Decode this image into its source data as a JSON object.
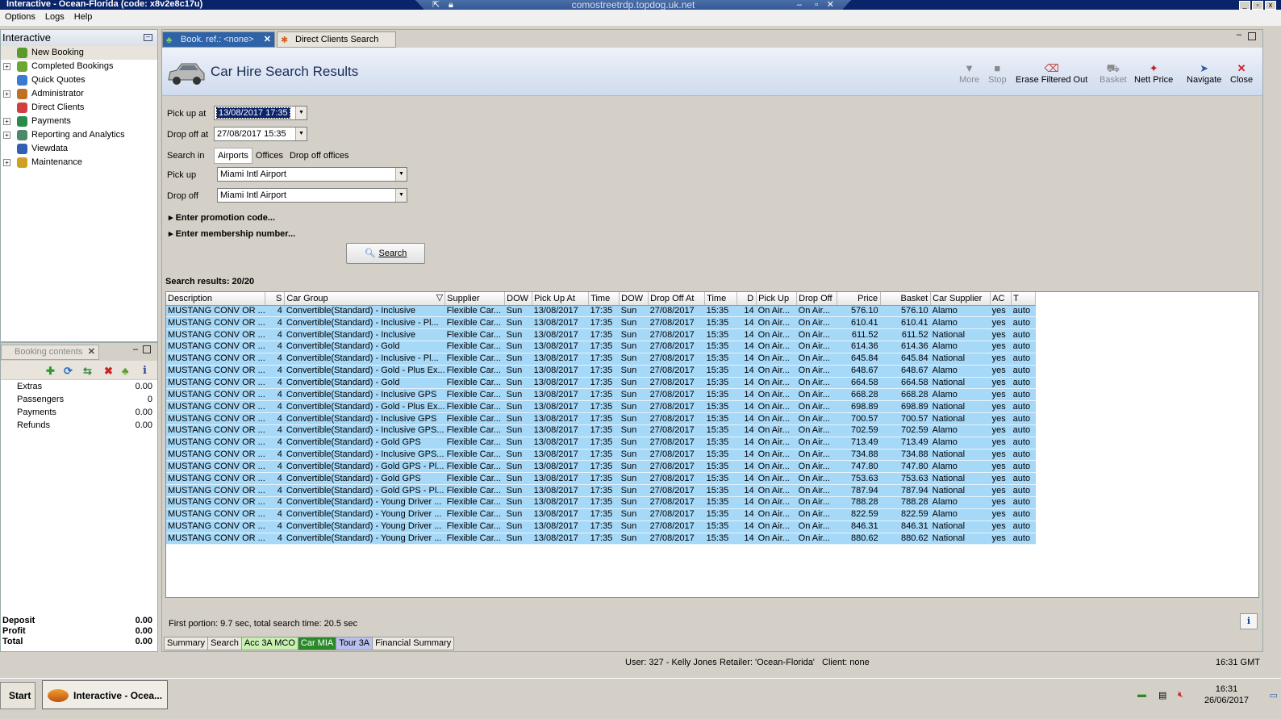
{
  "window": {
    "title": "Interactive - Ocean-Florida (code: x8v2e8c17u)",
    "rdp_host": "comostreetrdp.topdog.uk.net"
  },
  "menu": [
    "Options",
    "Logs",
    "Help"
  ],
  "tree": {
    "title": "Interactive",
    "items": [
      {
        "label": "New Booking",
        "expand": "",
        "color": "#5a9a2a",
        "sel": true
      },
      {
        "label": "Completed Bookings",
        "expand": "+",
        "color": "#6aa830"
      },
      {
        "label": "Quick Quotes",
        "expand": "",
        "color": "#3a7ad0"
      },
      {
        "label": "Administrator",
        "expand": "+",
        "color": "#c07020"
      },
      {
        "label": "Direct Clients",
        "expand": "",
        "color": "#d04040"
      },
      {
        "label": "Payments",
        "expand": "+",
        "color": "#2a8a4a"
      },
      {
        "label": "Reporting and Analytics",
        "expand": "+",
        "color": "#4a8a6a"
      },
      {
        "label": "Viewdata",
        "expand": "",
        "color": "#3060b0"
      },
      {
        "label": "Maintenance",
        "expand": "+",
        "color": "#d0a020"
      }
    ]
  },
  "booking": {
    "tab": "Booking contents",
    "rows": [
      {
        "label": "Extras",
        "value": "0.00"
      },
      {
        "label": "Passengers",
        "value": "0"
      },
      {
        "label": "Payments",
        "value": "0.00"
      },
      {
        "label": "Refunds",
        "value": "0.00"
      }
    ],
    "totals": [
      {
        "label": "Deposit",
        "value": "0.00"
      },
      {
        "label": "Profit",
        "value": "0.00"
      },
      {
        "label": "Total",
        "value": "0.00"
      }
    ]
  },
  "tabs": {
    "t1": "Book. ref.: <none>",
    "t2": "Direct Clients Search"
  },
  "header": {
    "title": "Car Hire Search Results"
  },
  "toolbar": {
    "more": "More",
    "stop": "Stop",
    "erase": "Erase Filtered Out",
    "basket": "Basket",
    "nett": "Nett Price",
    "navigate": "Navigate",
    "close": "Close"
  },
  "form": {
    "pickup_at_label": "Pick up at",
    "pickup_at": "13/08/2017 17:35",
    "dropoff_at_label": "Drop off at",
    "dropoff_at": "27/08/2017 15:35",
    "search_in_label": "Search in",
    "search_in": [
      "Airports",
      "Offices",
      "Drop off offices"
    ],
    "pickup_label": "Pick up",
    "pickup": "Miami Intl Airport",
    "dropoff_label": "Drop off",
    "dropoff": "Miami Intl Airport",
    "promo": "Enter promotion code...",
    "membership": "Enter membership number...",
    "search_btn": "Search"
  },
  "results_label": "Search results: 20/20",
  "columns": [
    "Description",
    "S",
    "Car Group",
    "Supplier",
    "DOW",
    "Pick Up At",
    "Time",
    "DOW",
    "Drop Off At",
    "Time",
    "D",
    "Pick Up",
    "Drop Off",
    "Price",
    "Basket",
    "Car Supplier",
    "AC",
    "T"
  ],
  "rows": [
    [
      "MUSTANG CONV OR ...",
      "4",
      "Convertible(Standard) - Inclusive",
      "Flexible Car...",
      "Sun",
      "13/08/2017",
      "17:35",
      "Sun",
      "27/08/2017",
      "15:35",
      "14",
      "On Air...",
      "On Air...",
      "576.10",
      "576.10",
      "Alamo",
      "yes",
      "auto"
    ],
    [
      "MUSTANG CONV OR ...",
      "4",
      "Convertible(Standard) - Inclusive - Pl...",
      "Flexible Car...",
      "Sun",
      "13/08/2017",
      "17:35",
      "Sun",
      "27/08/2017",
      "15:35",
      "14",
      "On Air...",
      "On Air...",
      "610.41",
      "610.41",
      "Alamo",
      "yes",
      "auto"
    ],
    [
      "MUSTANG CONV OR ...",
      "4",
      "Convertible(Standard) - Inclusive",
      "Flexible Car...",
      "Sun",
      "13/08/2017",
      "17:35",
      "Sun",
      "27/08/2017",
      "15:35",
      "14",
      "On Air...",
      "On Air...",
      "611.52",
      "611.52",
      "National",
      "yes",
      "auto"
    ],
    [
      "MUSTANG CONV OR ...",
      "4",
      "Convertible(Standard) - Gold",
      "Flexible Car...",
      "Sun",
      "13/08/2017",
      "17:35",
      "Sun",
      "27/08/2017",
      "15:35",
      "14",
      "On Air...",
      "On Air...",
      "614.36",
      "614.36",
      "Alamo",
      "yes",
      "auto"
    ],
    [
      "MUSTANG CONV OR ...",
      "4",
      "Convertible(Standard) - Inclusive - Pl...",
      "Flexible Car...",
      "Sun",
      "13/08/2017",
      "17:35",
      "Sun",
      "27/08/2017",
      "15:35",
      "14",
      "On Air...",
      "On Air...",
      "645.84",
      "645.84",
      "National",
      "yes",
      "auto"
    ],
    [
      "MUSTANG CONV OR ...",
      "4",
      "Convertible(Standard) - Gold - Plus Ex...",
      "Flexible Car...",
      "Sun",
      "13/08/2017",
      "17:35",
      "Sun",
      "27/08/2017",
      "15:35",
      "14",
      "On Air...",
      "On Air...",
      "648.67",
      "648.67",
      "Alamo",
      "yes",
      "auto"
    ],
    [
      "MUSTANG CONV OR ...",
      "4",
      "Convertible(Standard) - Gold",
      "Flexible Car...",
      "Sun",
      "13/08/2017",
      "17:35",
      "Sun",
      "27/08/2017",
      "15:35",
      "14",
      "On Air...",
      "On Air...",
      "664.58",
      "664.58",
      "National",
      "yes",
      "auto"
    ],
    [
      "MUSTANG CONV OR ...",
      "4",
      "Convertible(Standard) - Inclusive GPS",
      "Flexible Car...",
      "Sun",
      "13/08/2017",
      "17:35",
      "Sun",
      "27/08/2017",
      "15:35",
      "14",
      "On Air...",
      "On Air...",
      "668.28",
      "668.28",
      "Alamo",
      "yes",
      "auto"
    ],
    [
      "MUSTANG CONV OR ...",
      "4",
      "Convertible(Standard) - Gold - Plus Ex...",
      "Flexible Car...",
      "Sun",
      "13/08/2017",
      "17:35",
      "Sun",
      "27/08/2017",
      "15:35",
      "14",
      "On Air...",
      "On Air...",
      "698.89",
      "698.89",
      "National",
      "yes",
      "auto"
    ],
    [
      "MUSTANG CONV OR ...",
      "4",
      "Convertible(Standard) - Inclusive GPS",
      "Flexible Car...",
      "Sun",
      "13/08/2017",
      "17:35",
      "Sun",
      "27/08/2017",
      "15:35",
      "14",
      "On Air...",
      "On Air...",
      "700.57",
      "700.57",
      "National",
      "yes",
      "auto"
    ],
    [
      "MUSTANG CONV OR ...",
      "4",
      "Convertible(Standard) - Inclusive GPS...",
      "Flexible Car...",
      "Sun",
      "13/08/2017",
      "17:35",
      "Sun",
      "27/08/2017",
      "15:35",
      "14",
      "On Air...",
      "On Air...",
      "702.59",
      "702.59",
      "Alamo",
      "yes",
      "auto"
    ],
    [
      "MUSTANG CONV OR ...",
      "4",
      "Convertible(Standard) - Gold GPS",
      "Flexible Car...",
      "Sun",
      "13/08/2017",
      "17:35",
      "Sun",
      "27/08/2017",
      "15:35",
      "14",
      "On Air...",
      "On Air...",
      "713.49",
      "713.49",
      "Alamo",
      "yes",
      "auto"
    ],
    [
      "MUSTANG CONV OR ...",
      "4",
      "Convertible(Standard) - Inclusive GPS...",
      "Flexible Car...",
      "Sun",
      "13/08/2017",
      "17:35",
      "Sun",
      "27/08/2017",
      "15:35",
      "14",
      "On Air...",
      "On Air...",
      "734.88",
      "734.88",
      "National",
      "yes",
      "auto"
    ],
    [
      "MUSTANG CONV OR ...",
      "4",
      "Convertible(Standard) - Gold GPS - Pl...",
      "Flexible Car...",
      "Sun",
      "13/08/2017",
      "17:35",
      "Sun",
      "27/08/2017",
      "15:35",
      "14",
      "On Air...",
      "On Air...",
      "747.80",
      "747.80",
      "Alamo",
      "yes",
      "auto"
    ],
    [
      "MUSTANG CONV OR ...",
      "4",
      "Convertible(Standard) - Gold GPS",
      "Flexible Car...",
      "Sun",
      "13/08/2017",
      "17:35",
      "Sun",
      "27/08/2017",
      "15:35",
      "14",
      "On Air...",
      "On Air...",
      "753.63",
      "753.63",
      "National",
      "yes",
      "auto"
    ],
    [
      "MUSTANG CONV OR ...",
      "4",
      "Convertible(Standard) - Gold GPS - Pl...",
      "Flexible Car...",
      "Sun",
      "13/08/2017",
      "17:35",
      "Sun",
      "27/08/2017",
      "15:35",
      "14",
      "On Air...",
      "On Air...",
      "787.94",
      "787.94",
      "National",
      "yes",
      "auto"
    ],
    [
      "MUSTANG CONV OR ...",
      "4",
      "Convertible(Standard) - Young Driver ...",
      "Flexible Car...",
      "Sun",
      "13/08/2017",
      "17:35",
      "Sun",
      "27/08/2017",
      "15:35",
      "14",
      "On Air...",
      "On Air...",
      "788.28",
      "788.28",
      "Alamo",
      "yes",
      "auto"
    ],
    [
      "MUSTANG CONV OR ...",
      "4",
      "Convertible(Standard) - Young Driver ...",
      "Flexible Car...",
      "Sun",
      "13/08/2017",
      "17:35",
      "Sun",
      "27/08/2017",
      "15:35",
      "14",
      "On Air...",
      "On Air...",
      "822.59",
      "822.59",
      "Alamo",
      "yes",
      "auto"
    ],
    [
      "MUSTANG CONV OR ...",
      "4",
      "Convertible(Standard) - Young Driver ...",
      "Flexible Car...",
      "Sun",
      "13/08/2017",
      "17:35",
      "Sun",
      "27/08/2017",
      "15:35",
      "14",
      "On Air...",
      "On Air...",
      "846.31",
      "846.31",
      "National",
      "yes",
      "auto"
    ],
    [
      "MUSTANG CONV OR ...",
      "4",
      "Convertible(Standard) - Young Driver ...",
      "Flexible Car...",
      "Sun",
      "13/08/2017",
      "17:35",
      "Sun",
      "27/08/2017",
      "15:35",
      "14",
      "On Air...",
      "On Air...",
      "880.62",
      "880.62",
      "National",
      "yes",
      "auto"
    ]
  ],
  "footer_timing": "First portion: 9.7 sec, total search time: 20.5 sec",
  "bottom_tabs": [
    {
      "label": "Summary",
      "color": "#ece9e2"
    },
    {
      "label": "Search",
      "color": "#ece9e2"
    },
    {
      "label": "Acc 3A MCO",
      "color": "#c8f0b0"
    },
    {
      "label": "Car MIA",
      "color": "#2a8a2a"
    },
    {
      "label": "Tour 3A",
      "color": "#b8c0f0"
    },
    {
      "label": "Financial Summary",
      "color": "#ece9e2"
    }
  ],
  "status": {
    "user": "User: 327 - Kelly Jones",
    "retailer": "Retailer: 'Ocean-Florida'",
    "client": "Client: none",
    "time": "16:31 GMT"
  },
  "taskbar": {
    "start": "Start",
    "task": "Interactive - Ocea...",
    "clock_time": "16:31",
    "clock_date": "26/06/2017"
  }
}
